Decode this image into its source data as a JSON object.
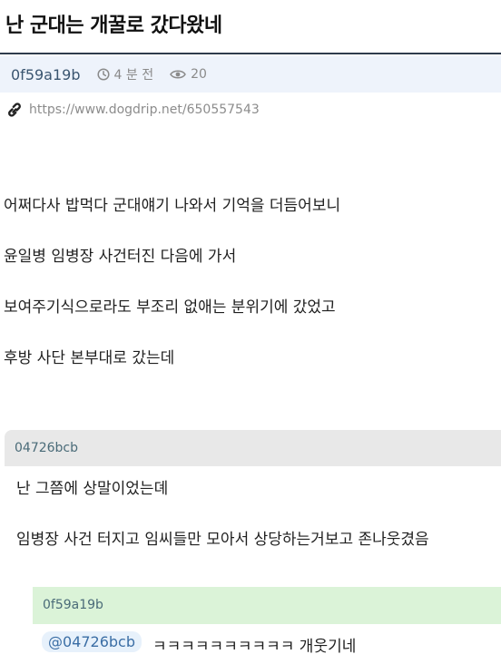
{
  "post": {
    "title": "난 군대는 개꿀로 갔다왔네",
    "author": "0f59a19b",
    "time": "4 분 전",
    "views": "20",
    "url": "https://www.dogdrip.net/650557543",
    "body": [
      "어쩌다사 밥먹다 군대얘기 나와서 기억을 더듬어보니",
      "윤일병 임병장 사건터진 다음에 가서",
      "보여주기식으로라도 부조리 없애는 분위기에 갔었고",
      "후방 사단 본부대로 갔는데"
    ]
  },
  "comment": {
    "author": "04726bcb",
    "lines": [
      "난 그쯤에 상말이었는뎨",
      "임병장 사건 터지고 임씨들만 모아서 상당하는거보고 존나웃겼음"
    ]
  },
  "reply": {
    "author": "0f59a19b",
    "mention": "@04726bcb",
    "text": "ㅋㅋㅋㅋㅋㅋㅋㅋㅋㅋ 개웃기네"
  },
  "colors": {
    "meta_bg": "#eef3fb",
    "comment_bg": "#e8e8e8",
    "reply_bg": "#dbf3d8",
    "mention_bg": "#e7f1fb",
    "mention_text": "#3b6ea5"
  },
  "icons": [
    "clock-icon",
    "eye-icon",
    "link-icon"
  ]
}
